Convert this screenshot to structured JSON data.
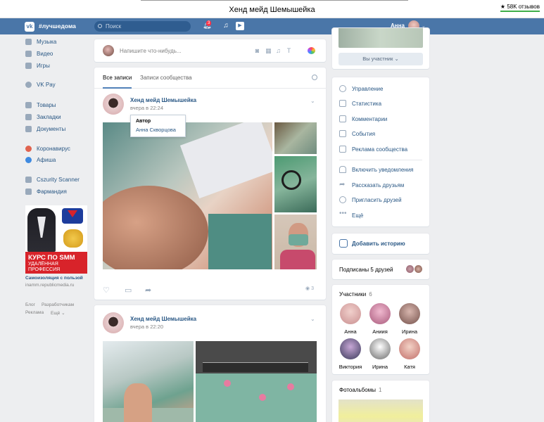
{
  "window": {
    "title": "Хенд мейд Шемышейка",
    "reviews": "58K отзывов",
    "reviews_star": "★"
  },
  "header": {
    "app_name": "#лучшедома",
    "search_placeholder": "Поиск",
    "notifications_count": "3",
    "user_name": "Анна"
  },
  "left_nav": {
    "items": [
      "Музыка",
      "Видео",
      "Игры",
      "VK Pay",
      "Товары",
      "Закладки",
      "Документы",
      "Коронавирус",
      "Афиша",
      "Cszurity Scanner",
      "Фармандия"
    ]
  },
  "ad": {
    "headline": "КУРС ПО SMM",
    "subline": "УДАЛЁННАЯ ПРОФЕССИЯ",
    "title": "Самоизоляция с пользой",
    "url": "inamm.republicmedia.ru"
  },
  "footer_links": [
    "Блог",
    "Разработчикам",
    "Реклама",
    "Ещё"
  ],
  "composer": {
    "placeholder": "Напишите что-нибудь..."
  },
  "wall": {
    "tabs": [
      "Все записи",
      "Записи сообщества"
    ],
    "posts": [
      {
        "author": "Хенд мейд Шемышейка",
        "date": "вчера в 22:24",
        "views": "3"
      },
      {
        "author": "Хенд мейд Шемышейка",
        "date": "вчера в 22:20"
      }
    ],
    "tooltip": {
      "title": "Автор",
      "name": "Анна Скворцова"
    }
  },
  "right": {
    "member_button": "Вы участник",
    "menu": [
      "Управление",
      "Статистика",
      "Комментарии",
      "События",
      "Реклама сообщества",
      "Включить уведомления",
      "Рассказать друзьям",
      "Пригласить друзей",
      "Ещё"
    ],
    "add_story": "Добавить историю",
    "friends_subscribed": "Подписаны 5 друзей",
    "members_label": "Участники",
    "members_count": "6",
    "members": [
      "Анна",
      "Аниия",
      "Ирина",
      "Виктория",
      "Ирина",
      "Катя"
    ],
    "albums_label": "Фотоальбомы",
    "albums_count": "1"
  },
  "colors": {
    "header_blue": "#4a76a8",
    "link": "#2a5885",
    "background": "#edeef0"
  }
}
